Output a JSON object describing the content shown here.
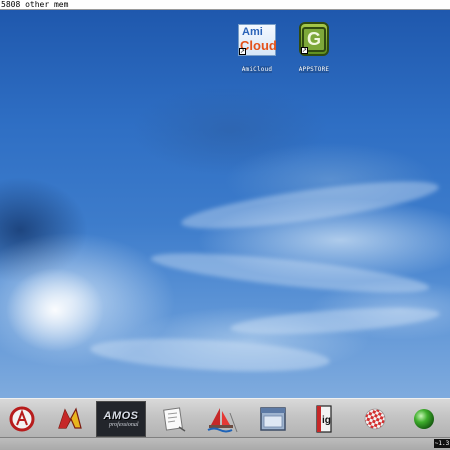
{
  "titlebar": {
    "text": "5808 other mem"
  },
  "desktop_icons": [
    {
      "name": "AmiCloud",
      "label": "AmiCloud",
      "logo_line1": "Ami",
      "logo_line2": "Cloud"
    },
    {
      "name": "AppStore",
      "label": "APPSTORE",
      "logo": "G"
    }
  ],
  "dock": {
    "items": [
      "aweb-icon",
      "n-logo-icon",
      "amos-icon",
      "notepad-icon",
      "ship-icon",
      "window-icon",
      "ig-icon",
      "boing-ball-icon",
      "green-sphere-icon"
    ],
    "amos_text": "AMOS",
    "amos_sub": "professional",
    "ig_text": "ig"
  },
  "bottom_badge": "~1.3",
  "colors": {
    "sky_top": "#1f58ad",
    "sky_bottom": "#7fabde",
    "dock": "#c4c4c4",
    "appstore_green": "#7da83a"
  }
}
